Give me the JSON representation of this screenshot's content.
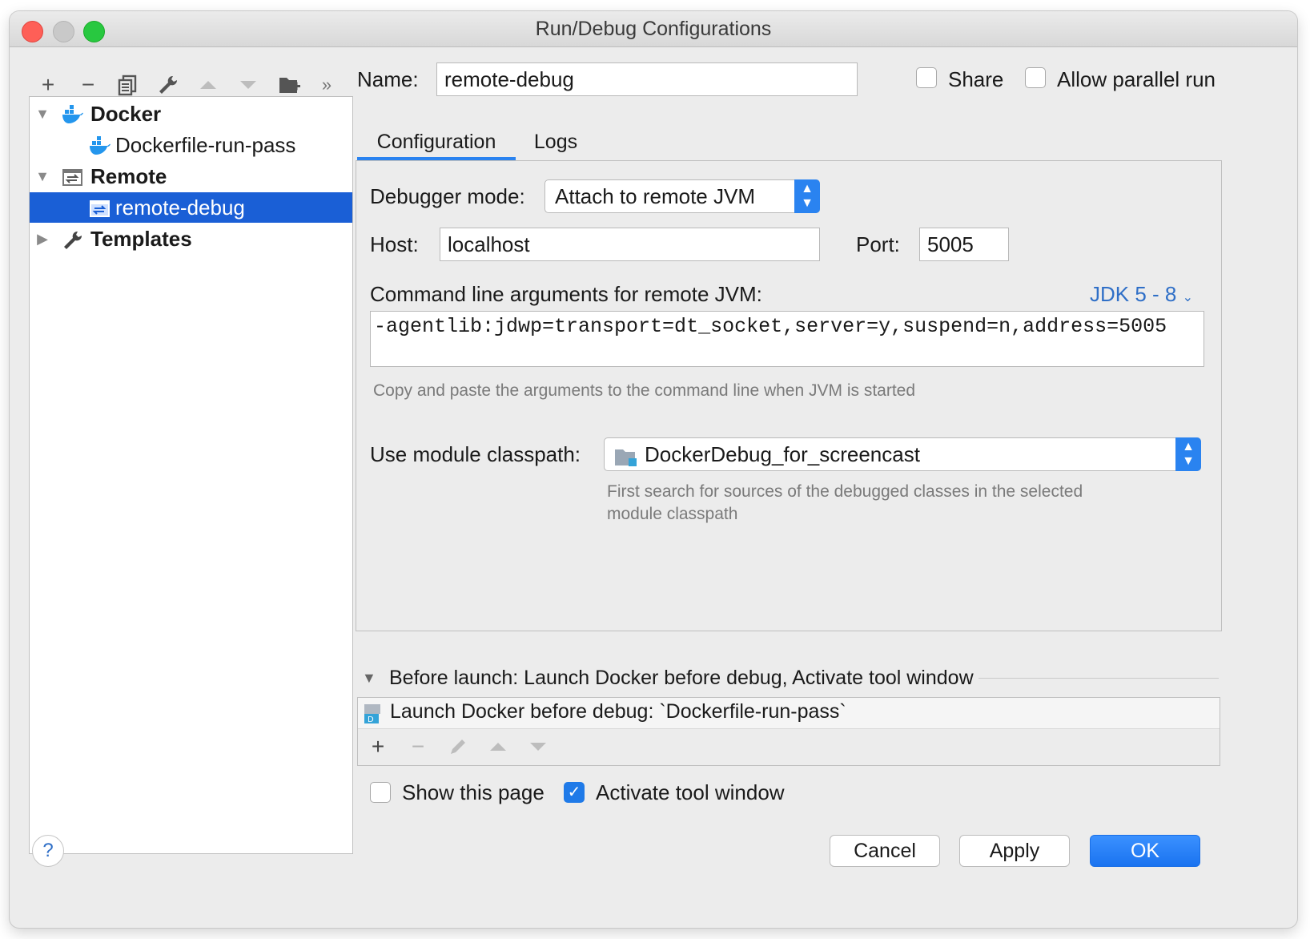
{
  "window": {
    "title": "Run/Debug Configurations",
    "traffic_colors": {
      "close": "#fe5f57",
      "minimize": "#c9c9c9",
      "zoom": "#28c840"
    }
  },
  "toolbar": {
    "icons": [
      "add-icon",
      "remove-icon",
      "copy-icon",
      "wrench-icon",
      "move-up-icon",
      "move-down-icon",
      "new-folder-icon",
      "more-icon"
    ],
    "glyphs": {
      "add": "+",
      "remove": "−",
      "more": "»"
    }
  },
  "tree": {
    "items": [
      {
        "label": "Docker",
        "expanded": true
      },
      {
        "label": "Dockerfile-run-pass"
      },
      {
        "label": "Remote",
        "expanded": true
      },
      {
        "label": "remote-debug",
        "selected": true
      },
      {
        "label": "Templates",
        "expanded": false
      }
    ]
  },
  "header": {
    "name_label": "Name:",
    "name_value": "remote-debug",
    "share_label": "Share",
    "share_checked": false,
    "parallel_label": "Allow parallel run",
    "parallel_checked": false
  },
  "tabs": [
    {
      "label": "Configuration",
      "active": true
    },
    {
      "label": "Logs",
      "active": false
    }
  ],
  "config": {
    "debugger_mode_label": "Debugger mode:",
    "debugger_mode_value": "Attach to remote JVM",
    "host_label": "Host:",
    "host_value": "localhost",
    "port_label": "Port:",
    "port_value": "5005",
    "cmd_label": "Command line arguments for remote JVM:",
    "jdk_link": "JDK 5 - 8",
    "cmd_value": "-agentlib:jdwp=transport=dt_socket,server=y,suspend=n,address=5005",
    "cmd_hint": "Copy and paste the arguments to the command line when JVM is started",
    "classpath_label": "Use module classpath:",
    "classpath_value": "DockerDebug_for_screencast",
    "classpath_hint_1": "First search for sources of the debugged classes in the selected",
    "classpath_hint_2": "module classpath"
  },
  "before_launch": {
    "header": "Before launch: Launch Docker before debug, Activate tool window",
    "task": "Launch Docker before debug: `Dockerfile-run-pass`",
    "show_page_label": "Show this page",
    "show_page_checked": false,
    "activate_label": "Activate tool window",
    "activate_checked": true
  },
  "footer": {
    "help": "?",
    "cancel": "Cancel",
    "apply": "Apply",
    "ok": "OK"
  },
  "colors": {
    "accent": "#1f7ae8",
    "selection": "#1a5fd6",
    "link": "#2f6fc7"
  }
}
